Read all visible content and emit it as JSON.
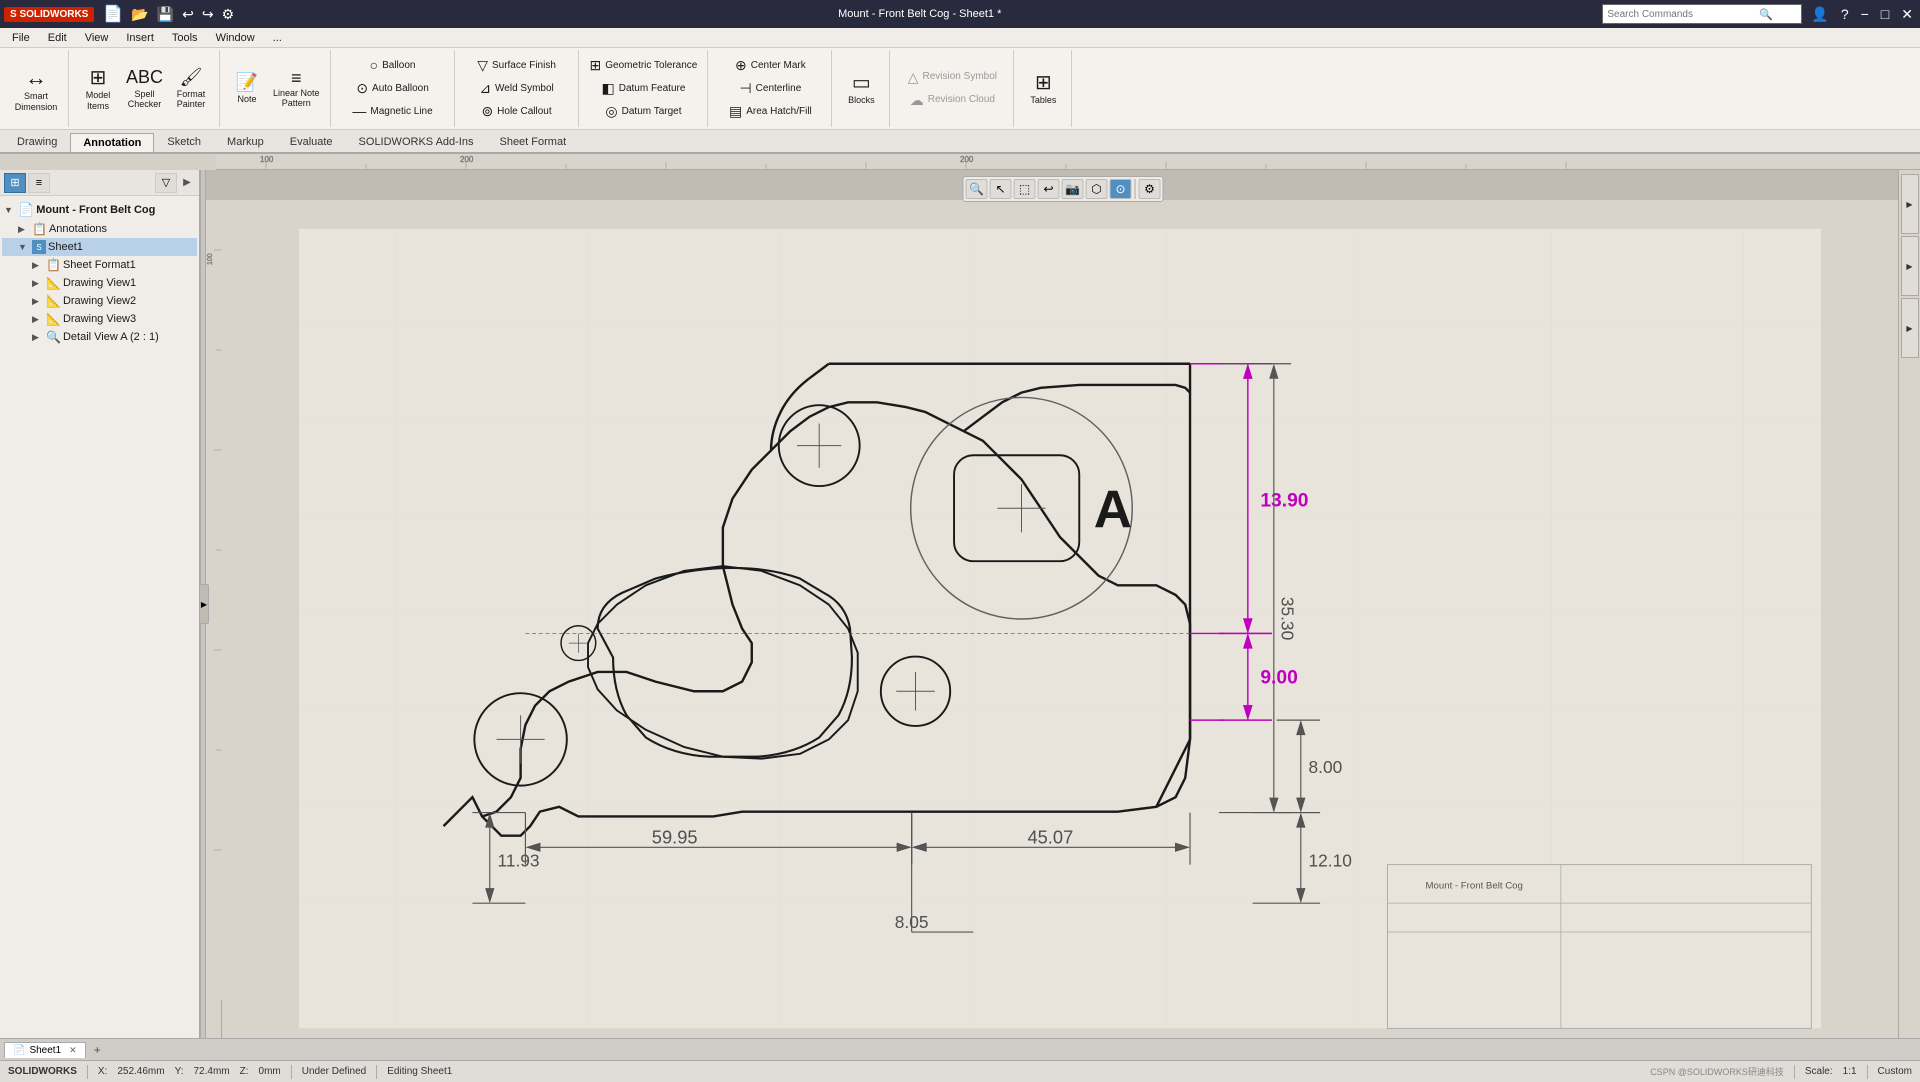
{
  "app": {
    "name": "SOLIDWORKS",
    "title": "Mount - Front Belt Cog - Sheet1 *"
  },
  "titlebar": {
    "title": "Mount - Front Belt Cog - Sheet1 *",
    "search_placeholder": "Search Commands",
    "help_icon": "?",
    "min": "−",
    "max": "□",
    "close": "✕"
  },
  "menubar": {
    "items": [
      "File",
      "Edit",
      "View",
      "Insert",
      "Tools",
      "Window"
    ]
  },
  "ribbon": {
    "tabs": [
      "Drawing",
      "Annotation",
      "Sketch",
      "Markup",
      "Evaluate",
      "SOLIDWORKS Add-Ins",
      "Sheet Format"
    ],
    "active_tab": "Annotation",
    "groups": {
      "smart_dimension": {
        "label": "Smart\nDimension",
        "icon": "↔"
      },
      "model_items": {
        "label": "Model\nItems",
        "icon": "⊞"
      },
      "spell_checker": {
        "label": "Spell\nChecker",
        "icon": "ABC"
      },
      "format_painter": {
        "label": "Format\nPainter",
        "icon": "🖌"
      },
      "note": {
        "label": "Note",
        "icon": "📝"
      },
      "linear_note": {
        "label": "Linear Note\nPattern",
        "icon": "≡"
      },
      "balloon": {
        "label": "Balloon",
        "icon": "○"
      },
      "auto_balloon": {
        "label": "Auto Balloon",
        "icon": "⊙"
      },
      "surface_finish": {
        "label": "Surface Finish",
        "icon": "▽"
      },
      "weld_symbol": {
        "label": "Weld Symbol",
        "icon": "⊿"
      },
      "magnetic_line": {
        "label": "Magnetic Line",
        "icon": "—"
      },
      "hole_callout": {
        "label": "Hole Callout",
        "icon": "⊚"
      },
      "geometric_tolerance": {
        "label": "Geometric\nTolerance",
        "icon": "⊞"
      },
      "datum_feature": {
        "label": "Datum Feature",
        "icon": "◧"
      },
      "datum_target": {
        "label": "Datum Target",
        "icon": "◎"
      },
      "center_mark": {
        "label": "Center Mark",
        "icon": "⊕"
      },
      "centerline": {
        "label": "Centerline",
        "icon": "⊣"
      },
      "area_hatch": {
        "label": "Area Hatch/Fill",
        "icon": "▤"
      },
      "blocks": {
        "label": "Blocks",
        "icon": "▭"
      },
      "revision_symbol": {
        "label": "Revision Symbol",
        "icon": "△"
      },
      "revision_cloud": {
        "label": "Revision Cloud",
        "icon": "☁"
      },
      "tables": {
        "label": "Tables",
        "icon": "⊞"
      }
    }
  },
  "feature_tree": {
    "root": {
      "label": "Mount - Front Belt Cog",
      "icon": "📄",
      "children": [
        {
          "label": "Annotations",
          "icon": "📋",
          "indent": 1
        },
        {
          "label": "Sheet1",
          "icon": "📄",
          "indent": 1,
          "selected": true,
          "children": [
            {
              "label": "Sheet Format1",
              "icon": "📋",
              "indent": 2
            },
            {
              "label": "Drawing View1",
              "icon": "📐",
              "indent": 2
            },
            {
              "label": "Drawing View2",
              "icon": "📐",
              "indent": 2
            },
            {
              "label": "Drawing View3",
              "icon": "📐",
              "indent": 2
            },
            {
              "label": "Detail View A (2 : 1)",
              "icon": "🔍",
              "indent": 2
            }
          ]
        }
      ]
    }
  },
  "dimensions": {
    "dim1": "13.90",
    "dim2": "35.30",
    "dim3": "9.00",
    "dim4": "8.00",
    "dim5": "12.10",
    "dim6": "59.95",
    "dim7": "45.07",
    "dim8": "11.93",
    "dim9": "8.05"
  },
  "detail_label": "A",
  "statusbar": {
    "x": "252.46mm",
    "y": "72.4mm",
    "z": "0mm",
    "status": "Under Defined",
    "editing": "Editing Sheet1",
    "app": "SOLIDWORKS",
    "scale": "1:1",
    "units": "Custom",
    "watermark": "CSPN @SOLIDWORKS研迪科技"
  },
  "sheet_tabs": {
    "tabs": [
      "Sheet1"
    ],
    "active": "Sheet1"
  },
  "viewport_tools": [
    "🔍",
    "🔄",
    "↕",
    "↩",
    "📷",
    "🖥",
    "💡"
  ],
  "colors": {
    "dimension_magenta": "#c000c0",
    "dimension_dark": "#505050",
    "background": "#e8e4dc",
    "grid": "#d0ccc4",
    "line_dark": "#1a1a1a",
    "detail_circle": "#606060"
  }
}
